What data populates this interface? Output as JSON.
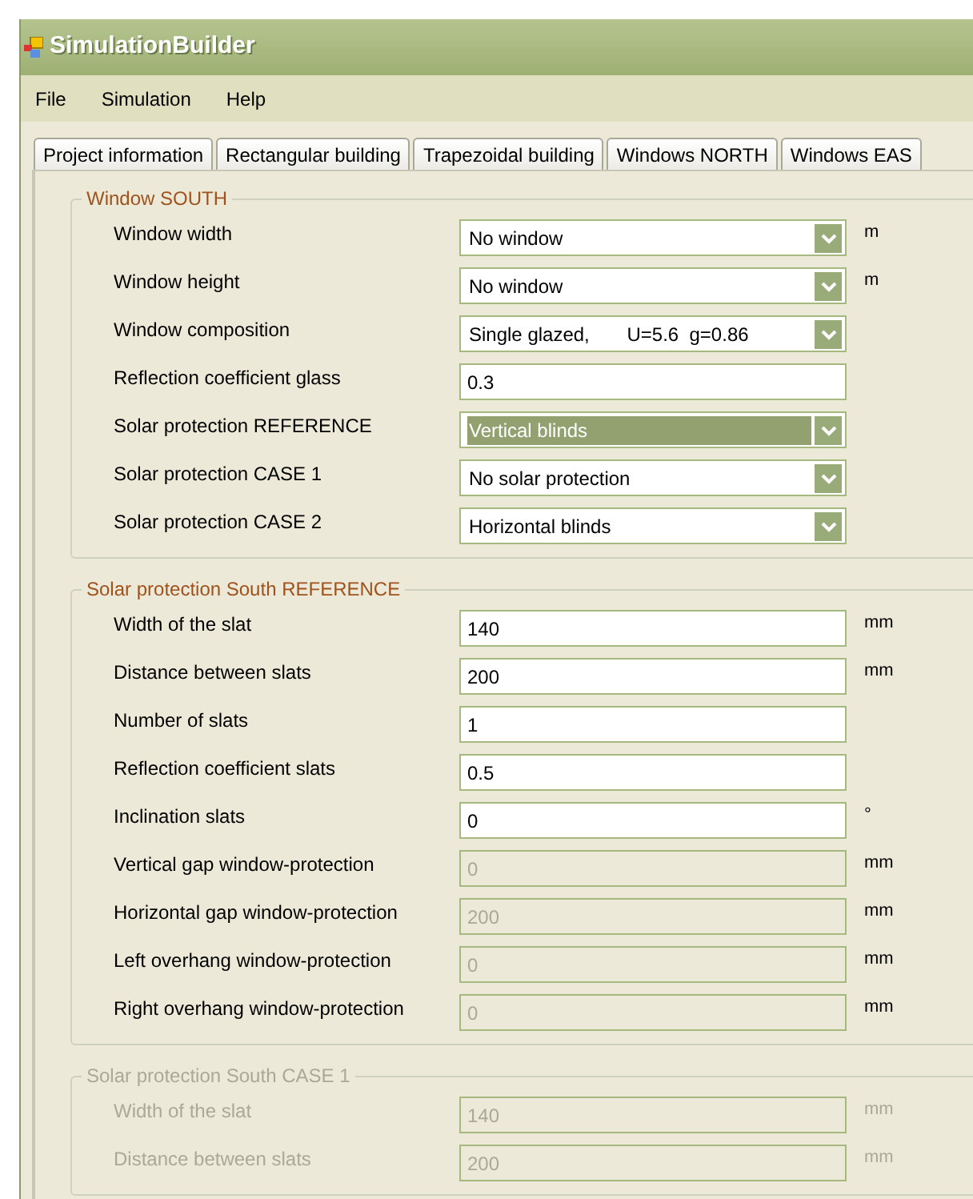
{
  "window": {
    "title": "SimulationBuilder"
  },
  "menu": [
    "File",
    "Simulation",
    "Help"
  ],
  "tabs": [
    {
      "label": "Project information",
      "selected": false
    },
    {
      "label": "Rectangular building",
      "selected": false
    },
    {
      "label": "Trapezoidal building",
      "selected": false
    },
    {
      "label": "Windows NORTH",
      "selected": false
    },
    {
      "label": "Windows EAS",
      "selected": false
    }
  ],
  "groups": [
    {
      "title": "Window SOUTH",
      "disabled": false,
      "rows": [
        {
          "label": "Window width",
          "kind": "dropdown",
          "value": "No window",
          "disabled": false,
          "focused": false,
          "unit": "m"
        },
        {
          "label": "Window height",
          "kind": "dropdown",
          "value": "No window",
          "disabled": false,
          "focused": false,
          "unit": "m"
        },
        {
          "label": "Window composition",
          "kind": "dropdown",
          "value": "Single glazed,       U=5.6  g=0.86",
          "disabled": false,
          "focused": false
        },
        {
          "label": "Reflection coefficient glass",
          "kind": "text",
          "value": "0.3",
          "disabled": false
        },
        {
          "label": "Solar protection REFERENCE",
          "kind": "dropdown",
          "value": "Vertical blinds",
          "disabled": false,
          "focused": true
        },
        {
          "label": "Solar protection CASE 1",
          "kind": "dropdown",
          "value": "No solar protection",
          "disabled": false,
          "focused": false
        },
        {
          "label": "Solar protection CASE 2",
          "kind": "dropdown",
          "value": "Horizontal blinds",
          "disabled": false,
          "focused": false
        }
      ]
    },
    {
      "title": "Solar protection South REFERENCE",
      "disabled": false,
      "rows": [
        {
          "label": "Width of the slat",
          "kind": "text",
          "value": "140",
          "disabled": false,
          "unit": "mm"
        },
        {
          "label": "Distance between slats",
          "kind": "text",
          "value": "200",
          "disabled": false,
          "unit": "mm"
        },
        {
          "label": "Number of slats",
          "kind": "text",
          "value": "1",
          "disabled": false
        },
        {
          "label": "Reflection coefficient slats",
          "kind": "text",
          "value": "0.5",
          "disabled": false
        },
        {
          "label": "Inclination slats",
          "kind": "text",
          "value": "0",
          "disabled": false,
          "unit": "°"
        },
        {
          "label": "Vertical gap window-protection",
          "kind": "text",
          "value": "0",
          "disabled": true,
          "unit": "mm"
        },
        {
          "label": "Horizontal gap window-protection",
          "kind": "text",
          "value": "200",
          "disabled": true,
          "unit": "mm"
        },
        {
          "label": "Left overhang window-protection",
          "kind": "text",
          "value": "0",
          "disabled": true,
          "unit": "mm"
        },
        {
          "label": "Right overhang window-protection",
          "kind": "text",
          "value": "0",
          "disabled": true,
          "unit": "mm"
        }
      ]
    },
    {
      "title": "Solar protection South CASE 1",
      "disabled": true,
      "rows": [
        {
          "label": "Width of the slat",
          "kind": "text",
          "value": "140",
          "disabled": true,
          "unit": "mm"
        },
        {
          "label": "Distance between slats",
          "kind": "text",
          "value": "200",
          "disabled": true,
          "unit": "mm"
        }
      ]
    }
  ]
}
